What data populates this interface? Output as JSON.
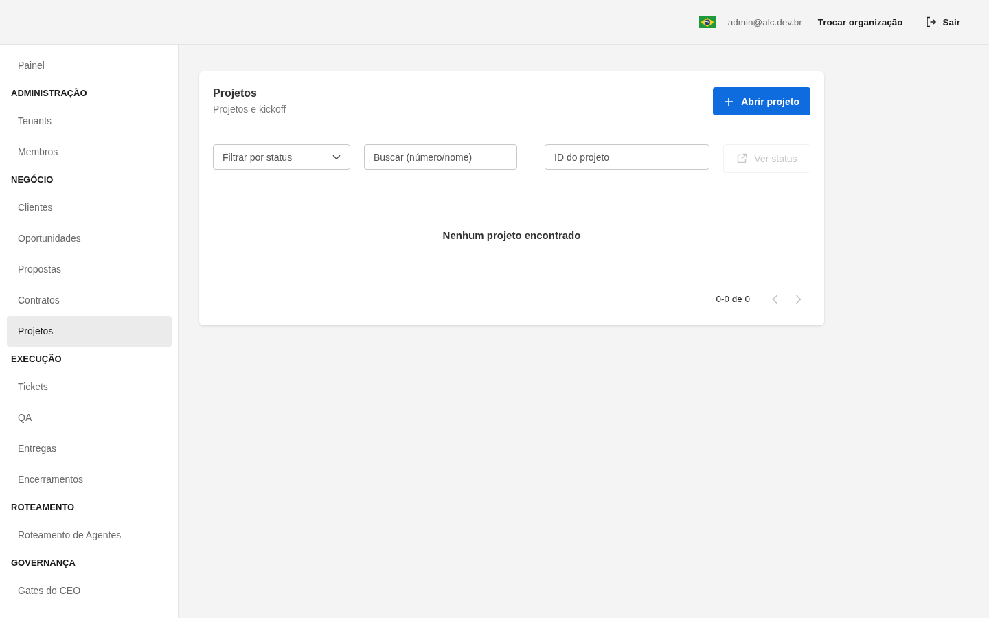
{
  "header": {
    "user_email": "admin@alc.dev.br",
    "switch_org_link": "Trocar organização",
    "logout_button": "Sair"
  },
  "sidebar": {
    "sections": [
      {
        "items": [
          {
            "label": "Painel",
            "selected": false
          }
        ]
      },
      {
        "title": "ADMINISTRAÇÃO",
        "items": [
          {
            "label": "Tenants",
            "selected": false
          },
          {
            "label": "Membros",
            "selected": false
          }
        ]
      },
      {
        "title": "NEGÓCIO",
        "items": [
          {
            "label": "Clientes",
            "selected": false
          },
          {
            "label": "Oportunidades",
            "selected": false
          },
          {
            "label": "Propostas",
            "selected": false
          },
          {
            "label": "Contratos",
            "selected": false
          },
          {
            "label": "Projetos",
            "selected": true
          }
        ]
      },
      {
        "title": "EXECUÇÃO",
        "items": [
          {
            "label": "Tickets",
            "selected": false
          },
          {
            "label": "QA",
            "selected": false
          },
          {
            "label": "Entregas",
            "selected": false
          },
          {
            "label": "Encerramentos",
            "selected": false
          }
        ]
      },
      {
        "title": "ROTEAMENTO",
        "items": [
          {
            "label": "Roteamento de Agentes",
            "selected": false
          }
        ]
      },
      {
        "title": "GOVERNANÇA",
        "items": [
          {
            "label": "Gates do CEO",
            "selected": false
          }
        ]
      }
    ]
  },
  "card": {
    "title": "Projetos",
    "subtitle": "Projetos e kickoff",
    "primary_button": {
      "label": "Abrir projeto"
    },
    "filters": {
      "status_select": {
        "placeholder": "Filtrar por status"
      },
      "search": {
        "placeholder": "Buscar (número/nome)"
      },
      "project_id": {
        "placeholder": "ID do projeto"
      },
      "view_status_button": {
        "label": "Ver status",
        "disabled": true
      }
    },
    "empty_message": "Nenhum projeto encontrado",
    "pagination": {
      "range": "0-0 de 0",
      "prev_disabled": true,
      "next_disabled": true
    }
  }
}
